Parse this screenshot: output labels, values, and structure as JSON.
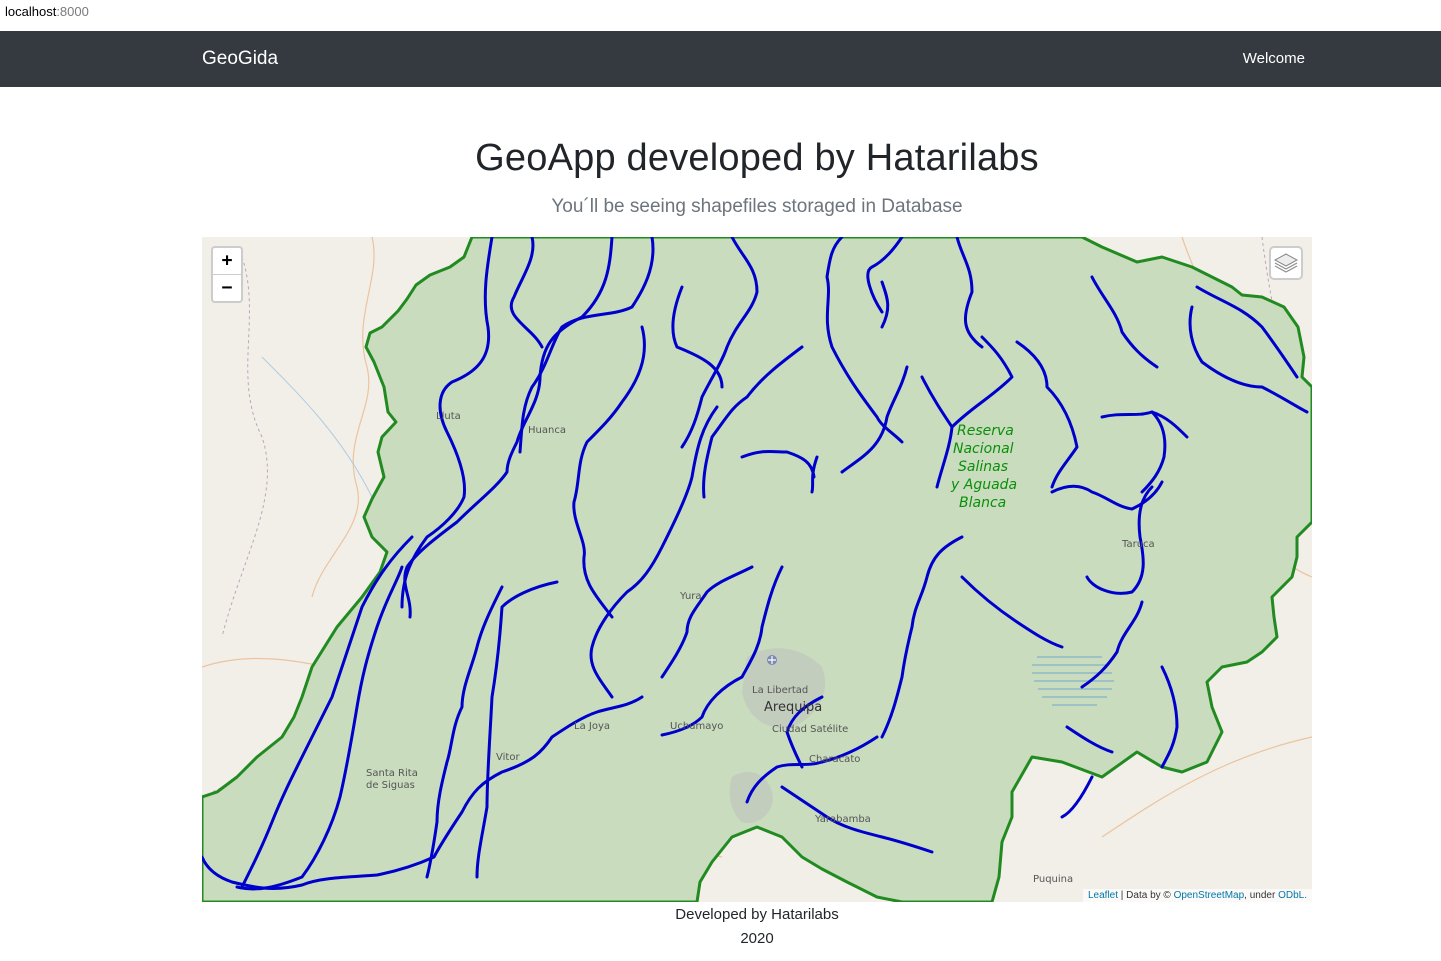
{
  "browser": {
    "host": "localhost",
    "port": ":8000"
  },
  "navbar": {
    "brand": "GeoGida",
    "welcome": "Welcome"
  },
  "main": {
    "title": "GeoApp developed by Hatarilabs",
    "subtitle": "You´ll be seeing shapefiles storaged in Database"
  },
  "map": {
    "zoom_in": "+",
    "zoom_out": "−",
    "layers_icon": "layers-icon",
    "colors": {
      "boundary": "#218a21",
      "rivers": "#0000cc",
      "basin_fill": "#c9dcbe",
      "background": "#f2efe9"
    },
    "places": {
      "lluta": "Lluta",
      "huanca": "Huanca",
      "taruca": "Taruca",
      "yura": "Yura",
      "la_libertad": "La Libertad",
      "arequipa": "Arequipa",
      "ciudad_satelite": "Ciudad Satélite",
      "la_joya": "La Joya",
      "uchumayo": "Uchumayo",
      "vitor": "Vitor",
      "characato": "Characato",
      "santa_rita_1": "Santa Rita",
      "santa_rita_2": "de Siguas",
      "yarabamba": "Yarabamba",
      "puquina": "Puquina"
    },
    "reserve_lines": [
      "Reserva",
      "Nacional",
      "Salinas",
      "y Aguada",
      "Blanca"
    ],
    "attribution": {
      "leaflet": "Leaflet",
      "sep": " | Data by © ",
      "osm": "OpenStreetMap",
      "under": ", under ",
      "odbl": "ODbL."
    }
  },
  "footer": {
    "line1": "Developed by Hatarilabs",
    "line2": "2020"
  }
}
